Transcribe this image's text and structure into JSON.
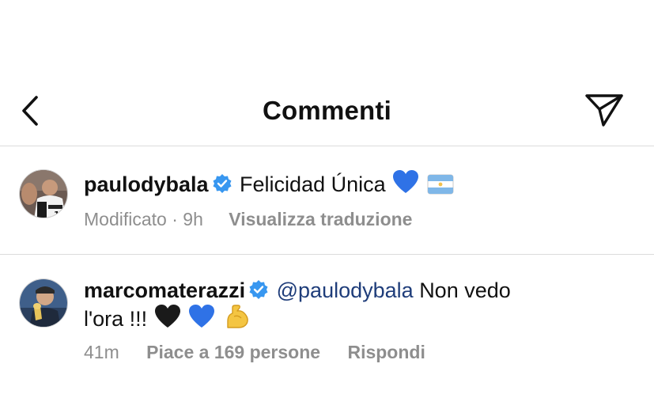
{
  "header": {
    "title": "Commenti"
  },
  "comments": [
    {
      "username": "paulodybala",
      "verified": true,
      "text": "Felicidad Única",
      "emojis": [
        "blue-heart",
        "argentina-flag"
      ],
      "edited_label": "Modificato",
      "separator": "·",
      "time": "9h",
      "translate_label": "Visualizza traduzione"
    },
    {
      "username": "marcomaterazzi",
      "verified": true,
      "mention": "@paulodybala",
      "text_line1": "Non vedo",
      "text_line2": "l'ora !!!",
      "emojis": [
        "black-heart",
        "blue-heart",
        "flexed-biceps"
      ],
      "time": "41m",
      "likes_label": "Piace a 169 persone",
      "reply_label": "Rispondi"
    }
  ],
  "colors": {
    "text": "#111111",
    "meta": "#8e8e8e",
    "verified": "#3897f0",
    "mention": "#1f3d7a",
    "divider": "#dcdcdc"
  }
}
